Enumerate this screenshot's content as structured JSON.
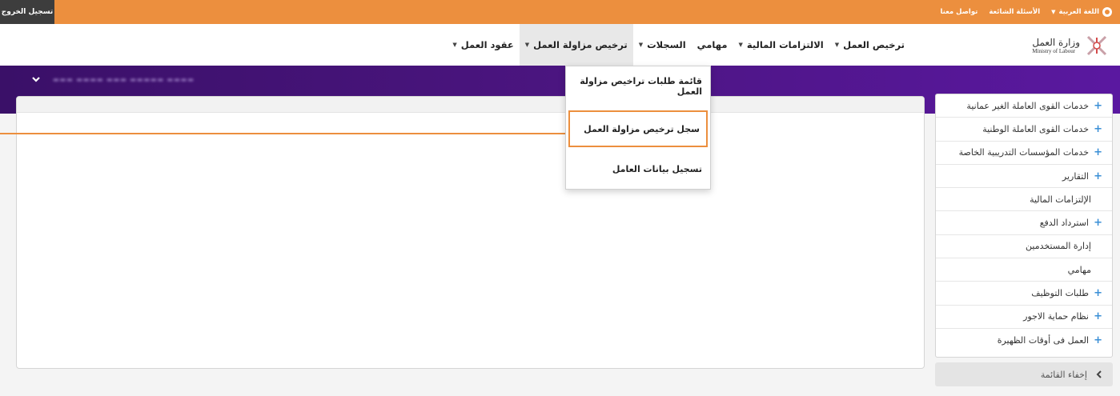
{
  "topbar": {
    "logout_label": "تسجيل الخروج",
    "language_label": "اللغة العربية",
    "faq_label": "الأسئلة الشائعة",
    "contact_label": "تواصل معنا",
    "color": "#ec8f3e"
  },
  "logo": {
    "arabic": "وزارة العمل",
    "english": "Ministry of Labour"
  },
  "nav": {
    "items": [
      {
        "label": "ترخيص العمل",
        "has_caret": true
      },
      {
        "label": "الالتزامات المالية",
        "has_caret": true
      },
      {
        "label": "مهامي",
        "has_caret": false
      },
      {
        "label": "السجلات",
        "has_caret": true
      },
      {
        "label": "ترخيص مزاولة العمل",
        "has_caret": true,
        "active": true
      },
      {
        "label": "عقود العمل",
        "has_caret": true
      }
    ]
  },
  "dropdown": {
    "items": [
      {
        "label": "قائمة طلبات تراخيص مزاولة العمل"
      },
      {
        "label": "سجل ترخيص مزاولة العمل",
        "highlighted": true
      },
      {
        "label": "تسجيل بيانات العامل"
      }
    ]
  },
  "sidebar": {
    "items": [
      {
        "label": "خدمات القوى العاملة الغير عمانية",
        "icon": "plus-icon"
      },
      {
        "label": "خدمات القوى العاملة الوطنية",
        "icon": "plus-icon"
      },
      {
        "label": "خدمات المؤسسات التدريبية الخاصة",
        "icon": "plus-icon"
      },
      {
        "label": "التقارير",
        "icon": "plus-icon"
      },
      {
        "label": "الإلتزامات المالية",
        "icon": ""
      },
      {
        "label": "استرداد الدفع",
        "icon": "plus-icon"
      },
      {
        "label": "إدارة المستخدمين",
        "icon": ""
      },
      {
        "label": "مهامي",
        "icon": ""
      },
      {
        "label": "طلبات التوظيف",
        "icon": "plus-icon"
      },
      {
        "label": "نظام حماية الاجور",
        "icon": "plus-icon"
      },
      {
        "label": "العمل فى أوقات الظهيرة",
        "icon": "plus-icon"
      }
    ],
    "hide_label": "إخفاء القائمة"
  }
}
